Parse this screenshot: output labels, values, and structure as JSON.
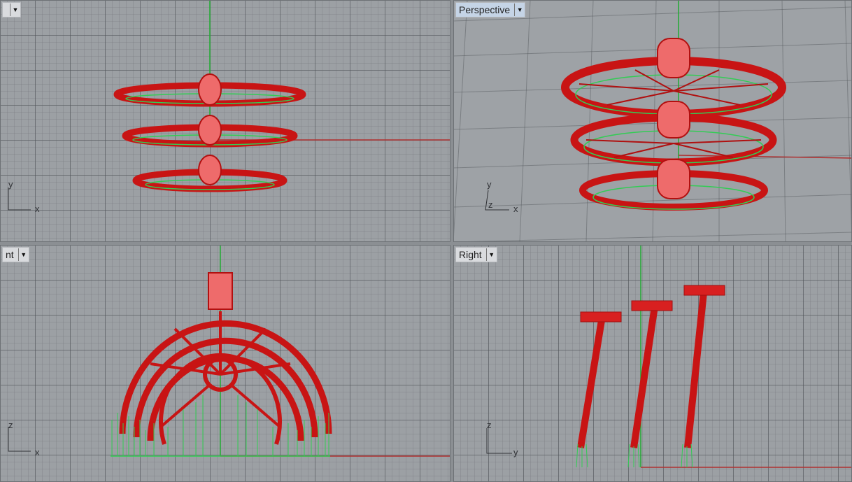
{
  "viewports": {
    "top": {
      "label": "",
      "axes": {
        "v": "y",
        "h": "x"
      }
    },
    "perspective": {
      "label": "Perspective",
      "axes": {
        "v": "y",
        "z": "z",
        "h": "x"
      }
    },
    "front": {
      "label": "nt",
      "axes": {
        "v": "z",
        "h": "x"
      }
    },
    "right": {
      "label": "Right",
      "axes": {
        "v": "z",
        "h": "y"
      }
    }
  },
  "icons": {
    "dropdown": "triangle-down-icon"
  },
  "colors": {
    "object": "#d21818",
    "highlight": "#f07070",
    "support": "#33cc55",
    "axis_x": "#b03030",
    "axis_y": "#22aa33",
    "grid": "#9ca0a4"
  }
}
